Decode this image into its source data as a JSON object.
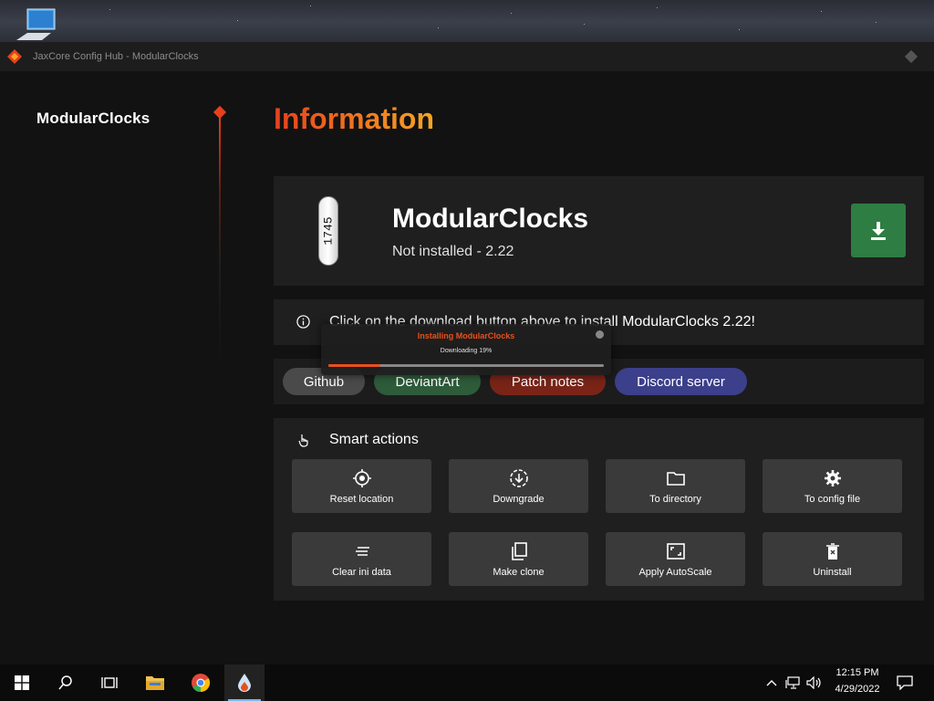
{
  "window": {
    "title": "JaxCore Config Hub - ModularClocks"
  },
  "sidebar": {
    "title": "ModularClocks"
  },
  "main": {
    "heading": "Information",
    "plugin": {
      "name": "ModularClocks",
      "status": "Not installed - 2.22",
      "thumb_text": "1745",
      "download_icon": "download-icon"
    },
    "info": {
      "text": "Click on the download button above to install ModularClocks 2.22!"
    },
    "links": [
      {
        "label": "Github",
        "color": "#4a4a4a"
      },
      {
        "label": "DeviantArt",
        "color": "#2e5b3a"
      },
      {
        "label": "Patch notes",
        "color": "#7a2418"
      },
      {
        "label": "Discord server",
        "color": "#3c3f8a"
      }
    ],
    "smart_actions": {
      "title": "Smart actions",
      "buttons": [
        {
          "label": "Reset location",
          "icon": "crosshair-icon"
        },
        {
          "label": "Downgrade",
          "icon": "downgrade-icon"
        },
        {
          "label": "To directory",
          "icon": "folder-icon"
        },
        {
          "label": "To config file",
          "icon": "gear-icon"
        },
        {
          "label": "Clear ini data",
          "icon": "clear-icon"
        },
        {
          "label": "Make clone",
          "icon": "clone-icon"
        },
        {
          "label": "Apply AutoScale",
          "icon": "autoscale-icon"
        },
        {
          "label": "Uninstall",
          "icon": "trash-icon"
        }
      ]
    }
  },
  "toast": {
    "title": "Installing ModularClocks",
    "subtitle": "Downloading 19%",
    "progress": 0.19
  },
  "taskbar": {
    "time": "12:15 PM",
    "date": "4/29/2022"
  },
  "colors": {
    "accent": "#e8401c",
    "accent_end": "#f6a623",
    "download_green": "#2e7d42"
  }
}
